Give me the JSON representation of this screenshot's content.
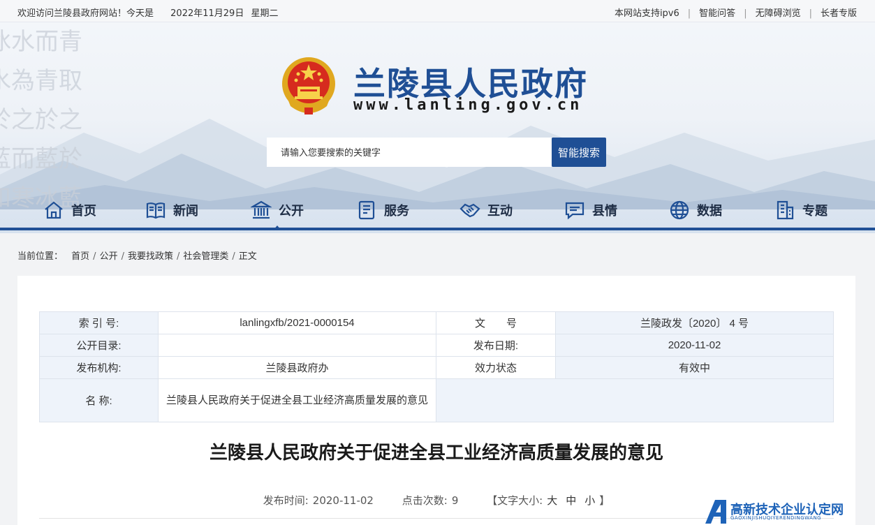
{
  "topbar": {
    "welcome": "欢迎访问兰陵县政府网站！今天是",
    "date": "2022年11月29日",
    "weekday": "星期二",
    "links": [
      "本网站支持ipv6",
      "智能问答",
      "无障碍浏览",
      "长者专版"
    ]
  },
  "header": {
    "site_title": "兰陵县人民政府",
    "site_url": "www.lanling.gov.cn",
    "calligraphy": [
      "冰水而青",
      "水為青取",
      "於之於之",
      "藍而藍於",
      "和寒冰藍"
    ]
  },
  "search": {
    "placeholder": "请输入您要搜索的关键字",
    "button": "智能搜索"
  },
  "nav": [
    {
      "label": "首页",
      "icon": "home-icon"
    },
    {
      "label": "新闻",
      "icon": "newspaper-icon"
    },
    {
      "label": "公开",
      "icon": "government-building-icon",
      "active": true
    },
    {
      "label": "服务",
      "icon": "service-document-icon"
    },
    {
      "label": "互动",
      "icon": "handshake-icon"
    },
    {
      "label": "县情",
      "icon": "chat-bubble-icon"
    },
    {
      "label": "数据",
      "icon": "data-globe-icon"
    },
    {
      "label": "专题",
      "icon": "building-icon"
    }
  ],
  "breadcrumb": {
    "label": "当前位置：",
    "items": [
      "首页",
      "公开",
      "我要找政策",
      "社会管理类",
      "正文"
    ]
  },
  "meta": {
    "index_no_label": "索 引 号:",
    "index_no": "lanlingxfb/2021-0000154",
    "doc_no_label": "文　　号",
    "doc_no": "兰陵政发〔2020〕 4 号",
    "catalog_label": "公开目录:",
    "catalog": "",
    "pub_date_label": "发布日期:",
    "pub_date": "2020-11-02",
    "org_label": "发布机构:",
    "org": "兰陵县政府办",
    "status_label": "效力状态",
    "status": "有效中",
    "name_label": "名 称:",
    "name": "兰陵县人民政府关于促进全县工业经济高质量发展的意见"
  },
  "article": {
    "title": "兰陵县人民政府关于促进全县工业经济高质量发展的意见",
    "pub_time_label": "发布时间:",
    "pub_time": "2020-11-02",
    "clicks_label": "点击次数:",
    "clicks": "9",
    "font_size_label": "【文字大小:",
    "font_large": "大",
    "font_medium": "中",
    "font_small": "小",
    "font_size_end": "】"
  },
  "watermark": {
    "text": "高新技术企业认定网",
    "sub": "GAOXINJISHUQIYERENDINGWANG"
  },
  "colors": {
    "brand_blue": "#1f4f95",
    "table_header": "#eef3fa"
  }
}
